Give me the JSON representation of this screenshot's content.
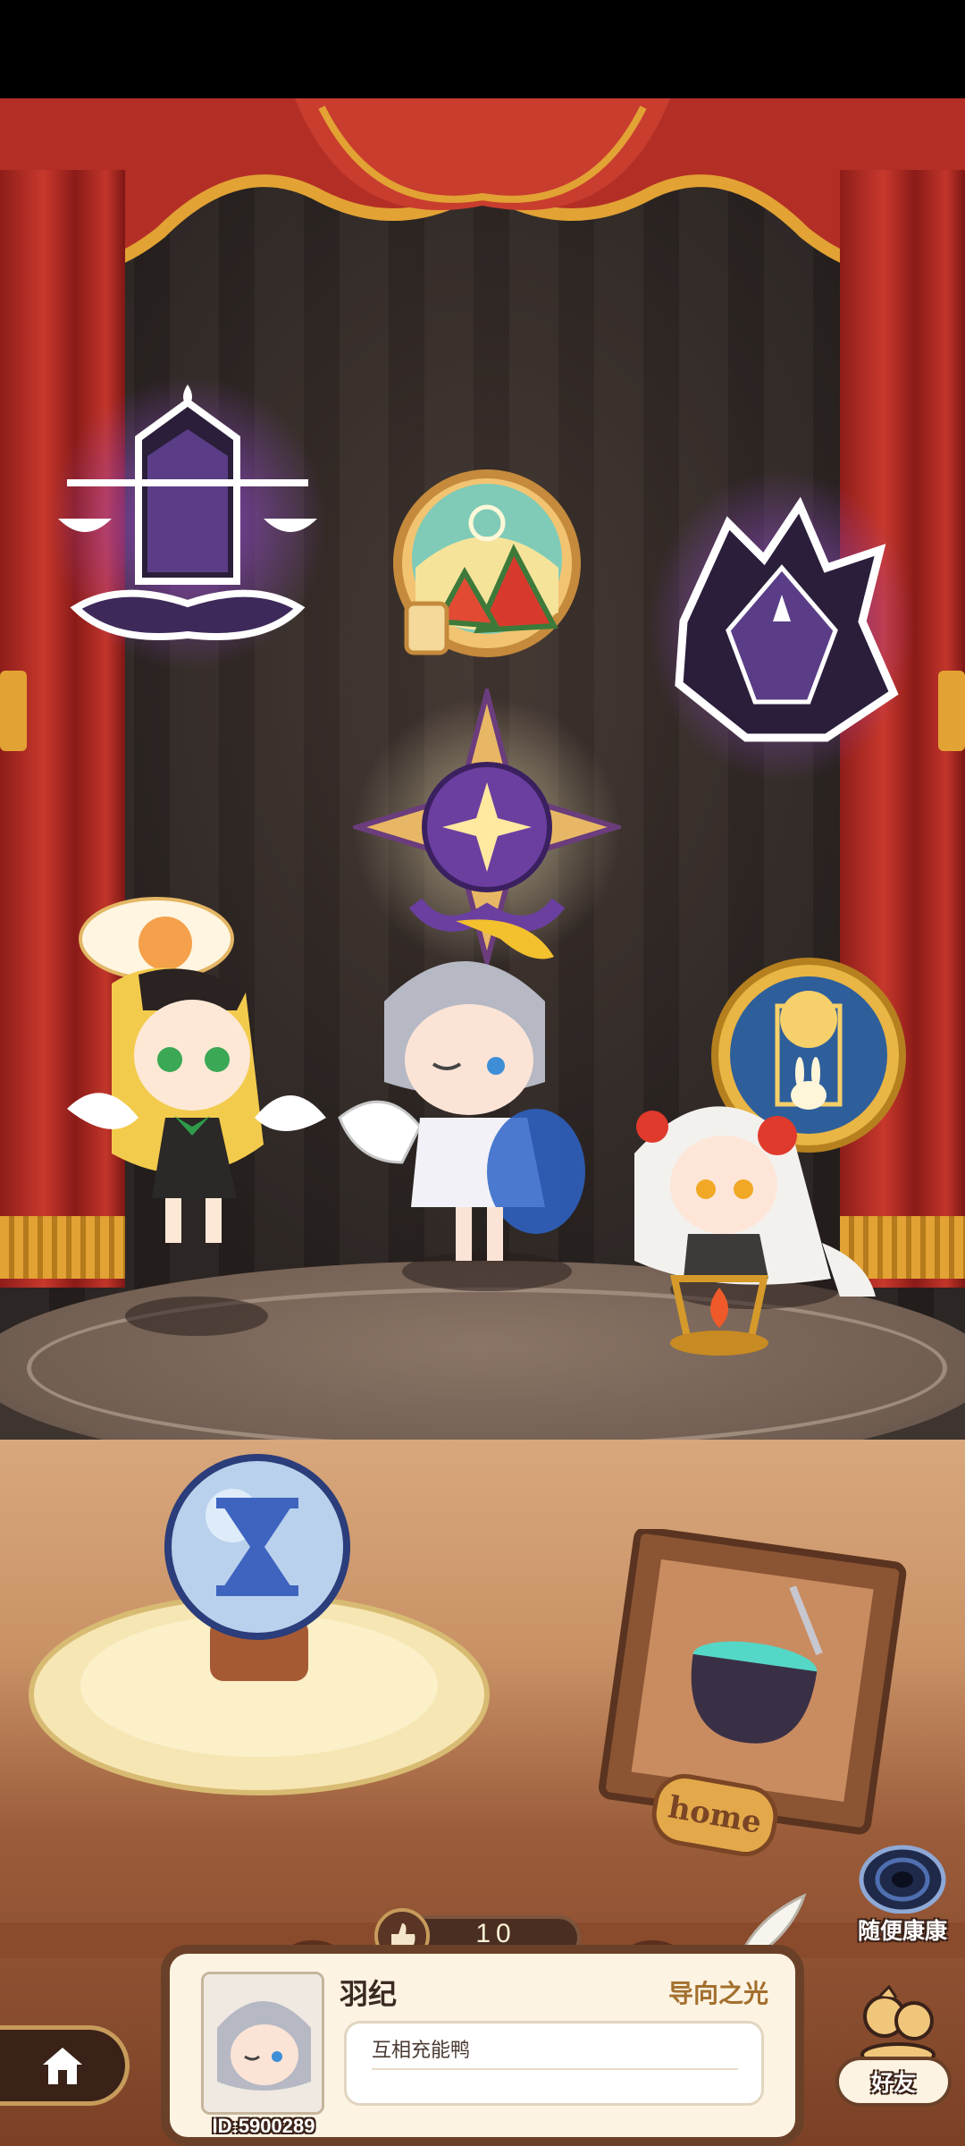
{
  "theme": {
    "curtain": "#c8382c",
    "gold": "#e2a234",
    "purple_glow": "#9a4fd6",
    "card_bg": "#fdf3e3",
    "card_border": "#6a4128"
  },
  "scene": {
    "emblems": [
      {
        "icon": "scales-lantern-emblem-icon"
      },
      {
        "icon": "watermelon-juice-emblem-icon"
      },
      {
        "icon": "dark-wolf-emblem-icon"
      },
      {
        "icon": "star-compass-emblem-icon"
      },
      {
        "icon": "moon-rabbit-emblem-icon"
      }
    ],
    "characters": [
      {
        "icon": "blonde-angel-character"
      },
      {
        "icon": "silver-hair-sleepy-character"
      },
      {
        "icon": "white-hair-lantern-character"
      }
    ],
    "hourglass_orb": {
      "icon": "hourglass-icon"
    },
    "home_frame": {
      "label": "home",
      "icon": "cauldron-picture-icon"
    }
  },
  "profile": {
    "likes": "10",
    "name": "羽纪",
    "title": "导向之光",
    "message": "互相充能鸭",
    "id_text": "ID:5900289"
  },
  "buttons": {
    "random_visit": "随便康康",
    "friends": "好友"
  }
}
